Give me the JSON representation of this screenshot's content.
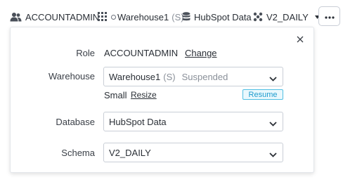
{
  "topbar": {
    "role": "ACCOUNTADMIN",
    "warehouse_name": "Warehouse1",
    "warehouse_size": "(S)",
    "database": "HubSpot Data",
    "schema": "V2_DAILY"
  },
  "panel": {
    "role": {
      "label": "Role",
      "value": "ACCOUNTADMIN",
      "action": "Change"
    },
    "warehouse": {
      "label": "Warehouse",
      "name": "Warehouse1",
      "size": "(S)",
      "status": "Suspended",
      "size_text": "Small",
      "resize_label": "Resize",
      "resume_label": "Resume"
    },
    "database": {
      "label": "Database",
      "value": "HubSpot Data"
    },
    "schema": {
      "label": "Schema",
      "value": "V2_DAILY"
    }
  },
  "colors": {
    "accent": "#1e9bcd",
    "accent_bg": "#eaf8fd",
    "border": "#c9ced6"
  },
  "icons": [
    "user-icon",
    "warehouse-grid-icon",
    "database-icon",
    "schema-icon",
    "caret-down-icon",
    "more-icon",
    "close-icon",
    "chevron-down-icon"
  ]
}
